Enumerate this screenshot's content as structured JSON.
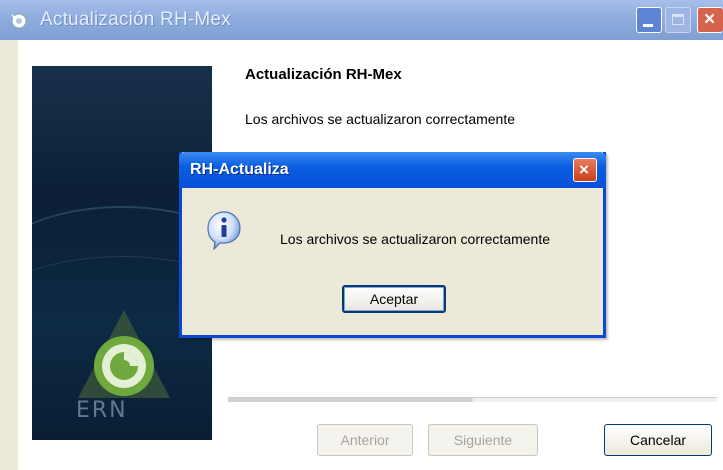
{
  "window": {
    "title": "Actualización RH-Mex",
    "controls": {
      "minimize": "minimize-icon",
      "maximize": "maximize-icon",
      "close": "×"
    }
  },
  "wizard": {
    "heading": "Actualización RH-Mex",
    "message": "Los archivos se actualizaron correctamente",
    "logo_text": "ERN",
    "buttons": {
      "back": "Anterior",
      "next": "Siguiente",
      "cancel": "Cancelar"
    },
    "progress": 0.5
  },
  "dialog": {
    "title": "RH-Actualiza",
    "message": "Los archivos se actualizaron correctamente",
    "icon": "info-icon",
    "close": "×",
    "ok_label": "Aceptar"
  },
  "colors": {
    "titlebar": "#8fadde",
    "dialog_titlebar": "#0a5fe0",
    "dialog_border": "#0a49d6",
    "window_bg": "#ece9d8",
    "side_panel": "#0b2036",
    "logo_green": "#6fa83c"
  }
}
